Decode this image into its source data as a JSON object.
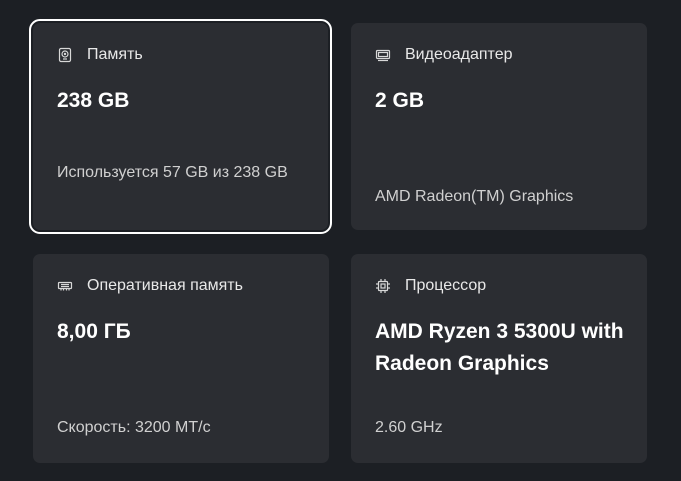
{
  "cards": [
    {
      "title": "Память",
      "icon": "hard-drive-icon",
      "value": "238 GB",
      "detail": "Используется 57 GB из 238 GB"
    },
    {
      "title": "Видеоадаптер",
      "icon": "gpu-icon",
      "value": "2 GB",
      "detail": "AMD Radeon(TM) Graphics"
    },
    {
      "title": "Оперативная память",
      "icon": "ram-icon",
      "value": "8,00 ГБ",
      "detail": "Скорость: 3200 МТ/с"
    },
    {
      "title": "Процессор",
      "icon": "cpu-icon",
      "value": "AMD Ryzen 3 5300U with Radeon Graphics",
      "detail": "2.60 GHz"
    }
  ],
  "colors": {
    "background": "#1c1f24",
    "card": "#2b2d32",
    "selection_outline": "#ffffff"
  }
}
